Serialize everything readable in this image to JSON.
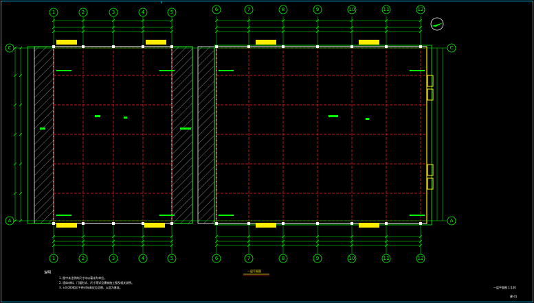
{
  "drawing": {
    "background": "#000000",
    "colors": {
      "frame": "#00ffff",
      "grid_red": "#ff2020",
      "wall_white": "#ffffff",
      "dim_green": "#00ff00",
      "yellow": "#ffee00",
      "magenta": "#ff40ff",
      "hatch": "#cccccc"
    },
    "left_axes_top": [
      "1",
      "2",
      "3",
      "4",
      "5"
    ],
    "right_axes_top": [
      "6",
      "7",
      "8",
      "9",
      "10",
      "11",
      "12"
    ],
    "left_axes_bottom": [
      "1",
      "2",
      "3",
      "4",
      "5"
    ],
    "right_axes_bottom": [
      "6",
      "7",
      "8",
      "9",
      "10",
      "11",
      "12"
    ],
    "row_axes": {
      "top": "C",
      "bottom": "A"
    },
    "north_arrow": "north-arrow",
    "notes_title": "说明",
    "notes": [
      "1. 图中未注明的尺寸均以毫米为单位。",
      "2. 墙体材料、门窗形式、尺寸等详见建筑施工图及相关说明。",
      "3. ±0.000相对于绝对标高详见总图，以此为基准。"
    ],
    "plan_title": "一层平面图",
    "sheet_title": "一层平面图 1:100",
    "page_ref": "建-01"
  }
}
